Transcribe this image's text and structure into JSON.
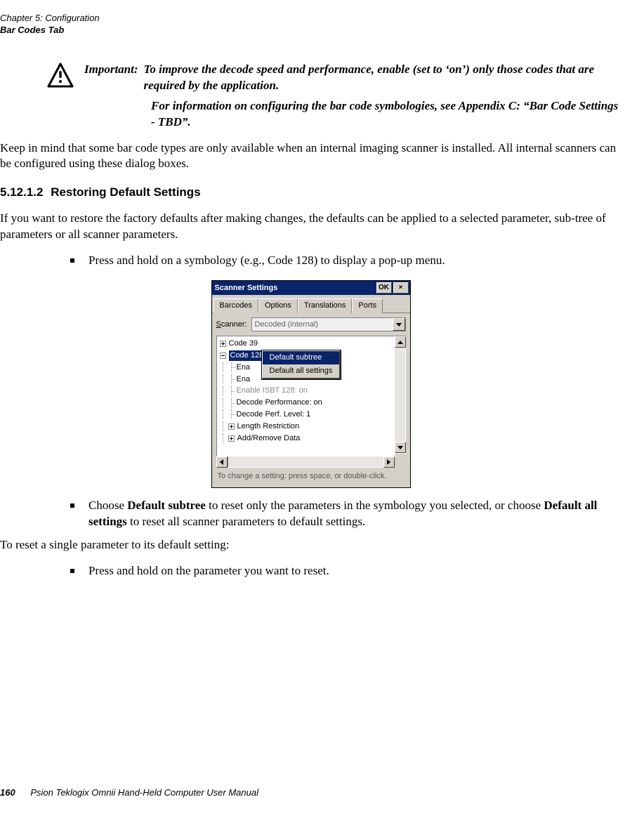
{
  "header": {
    "chapter_line": "Chapter 5:  Configuration",
    "section_line": "Bar Codes Tab"
  },
  "important": {
    "label": "Important:",
    "para1": "To improve the decode speed and performance, enable (set to ‘on’) only those codes that are required by the application.",
    "para2": "For information on configuring the bar code symbologies, see Appendix C: “Bar Code Settings - TBD”."
  },
  "body": {
    "p1": "Keep in mind that some bar code types are only available when an internal imaging scanner is installed. All internal scanners can be configured using these dialog boxes."
  },
  "section": {
    "number": "5.12.1.2",
    "title": "Restoring Default Settings",
    "intro": "If you want to restore the factory defaults after making changes, the defaults can be applied to a selected parameter, sub-tree of parameters or all scanner parameters.",
    "bullet1": "Press and hold on a symbology (e.g., Code 128) to display a pop-up menu.",
    "bullet2_pre": "Choose ",
    "bullet2_b1": "Default subtree",
    "bullet2_mid": " to reset only the parameters in the symbology you selected, or choose ",
    "bullet2_b2": "Default all settings",
    "bullet2_post": " to reset all scanner parameters to default settings.",
    "p_after": "To reset a single parameter to its default setting:",
    "bullet3": "Press and hold on the parameter you want to reset."
  },
  "dialog": {
    "title": "Scanner Settings",
    "ok": "OK",
    "close": "×",
    "tabs": [
      "Barcodes",
      "Options",
      "Translations",
      "Ports"
    ],
    "scanner_label_u": "S",
    "scanner_label_rest": "canner:",
    "scanner_value": "Decoded (internal)",
    "tree": {
      "code39": "Code 39",
      "code128": "Code 128",
      "ena1": "Ena",
      "ena2": "Ena",
      "enableISBT": "Enable ISBT 128: on",
      "decodePerf": "Decode Performance: on",
      "decodeLvl": "Decode Perf. Level: 1",
      "lenRest": "Length Restriction",
      "addremove": "Add/Remove Data"
    },
    "popup": {
      "subtree": "Default subtree",
      "all": "Default all settings"
    },
    "hint": "To change a setting: press space, or double-click."
  },
  "footer": {
    "page": "160",
    "title": "Psion Teklogix Omnii Hand-Held Computer User Manual"
  }
}
